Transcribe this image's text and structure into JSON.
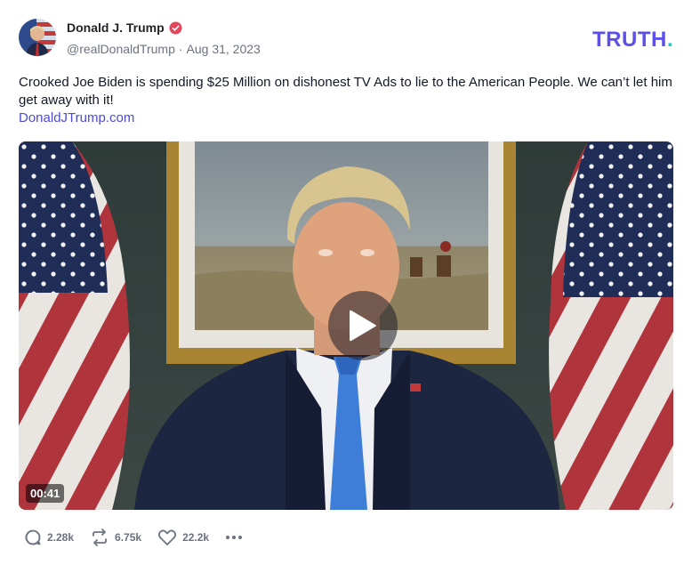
{
  "author": {
    "display_name": "Donald J. Trump",
    "handle": "@realDonaldTrump",
    "separator": "·",
    "date": "Aug 31, 2023",
    "verified_icon": "verified-badge-icon",
    "avatar_icon": "avatar-flag-portrait"
  },
  "brand": {
    "logo_text": "TRUTH",
    "logo_dot": ".",
    "logo_color": "#5b50e8",
    "dot_color": "#22c5c5"
  },
  "post": {
    "text": "Crooked Joe Biden is spending $25 Million on dishonest TV Ads to lie to the American People. We can’t let him get away with it!",
    "link": "DonaldJTrump.com"
  },
  "video": {
    "duration": "00:41",
    "play_icon": "play-icon"
  },
  "actions": {
    "replies": "2.28k",
    "reposts": "6.75k",
    "likes": "22.2k",
    "more_icon": "more-icon"
  },
  "colors": {
    "verified": "#e8445a",
    "link": "#4c4cd8"
  }
}
